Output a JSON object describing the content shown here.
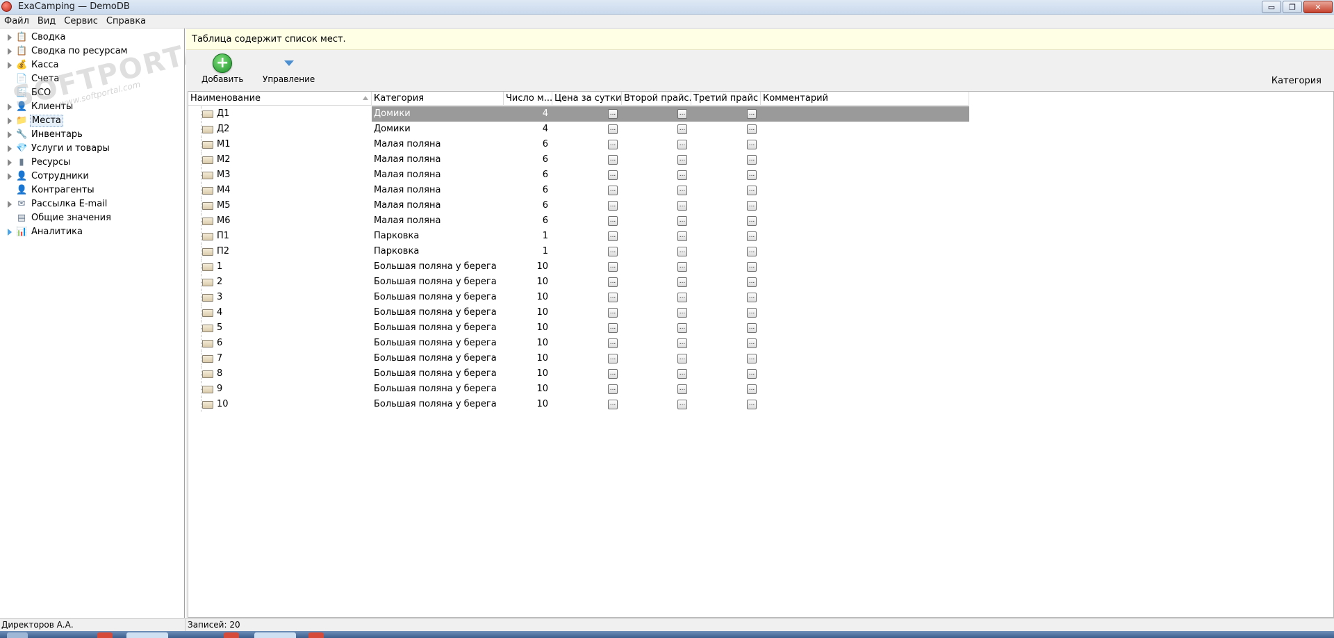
{
  "window": {
    "title": "ExaCamping — DemoDB",
    "min_label": "▭",
    "max_label": "❐",
    "close_label": "✕"
  },
  "menu": [
    "Файл",
    "Вид",
    "Сервис",
    "Справка"
  ],
  "sidebar": {
    "items": [
      {
        "label": "Сводка",
        "icon": "📋",
        "has_arrow": true
      },
      {
        "label": "Сводка по ресурсам",
        "icon": "📋",
        "has_arrow": true
      },
      {
        "label": "Касса",
        "icon": "💰",
        "has_arrow": true
      },
      {
        "label": "Счета",
        "icon": "📄",
        "has_arrow": false
      },
      {
        "label": "БСО",
        "icon": "🧾",
        "has_arrow": false
      },
      {
        "label": "Клиенты",
        "icon": "👤",
        "has_arrow": true
      },
      {
        "label": "Места",
        "icon": "📁",
        "has_arrow": true,
        "selected": true
      },
      {
        "label": "Инвентарь",
        "icon": "🔧",
        "has_arrow": true
      },
      {
        "label": "Услуги и товары",
        "icon": "💎",
        "has_arrow": true
      },
      {
        "label": "Ресурсы",
        "icon": "▮",
        "has_arrow": true
      },
      {
        "label": "Сотрудники",
        "icon": "👤",
        "has_arrow": true
      },
      {
        "label": "Контрагенты",
        "icon": "👤",
        "has_arrow": false
      },
      {
        "label": "Рассылка E-mail",
        "icon": "✉",
        "has_arrow": true
      },
      {
        "label": "Общие значения",
        "icon": "▤",
        "has_arrow": false
      },
      {
        "label": "Аналитика",
        "icon": "📊",
        "has_arrow": true,
        "blue_arrow": true
      }
    ]
  },
  "watermark": {
    "main": "SOFTPORTAL",
    "sub": "www.softportal.com"
  },
  "info_text": "Таблица содержит список мест.",
  "toolbar": {
    "add_label": "Добавить",
    "manage_label": "Управление",
    "category_label": "Категория"
  },
  "grid": {
    "columns": [
      "Наименование",
      "Категория",
      "Число м...",
      "Цена за сутки",
      "Второй прайс...",
      "Третий прайс ...",
      "Комментарий"
    ],
    "ellipsis": "...",
    "rows": [
      {
        "name": "Д1",
        "category": "Домики",
        "count": "4"
      },
      {
        "name": "Д2",
        "category": "Домики",
        "count": "4"
      },
      {
        "name": "М1",
        "category": "Малая поляна",
        "count": "6"
      },
      {
        "name": "М2",
        "category": "Малая поляна",
        "count": "6"
      },
      {
        "name": "М3",
        "category": "Малая поляна",
        "count": "6"
      },
      {
        "name": "М4",
        "category": "Малая поляна",
        "count": "6"
      },
      {
        "name": "М5",
        "category": "Малая поляна",
        "count": "6"
      },
      {
        "name": "М6",
        "category": "Малая поляна",
        "count": "6"
      },
      {
        "name": "П1",
        "category": "Парковка",
        "count": "1"
      },
      {
        "name": "П2",
        "category": "Парковка",
        "count": "1"
      },
      {
        "name": "1",
        "category": "Большая поляна у берега",
        "count": "10"
      },
      {
        "name": "2",
        "category": "Большая поляна у берега",
        "count": "10"
      },
      {
        "name": "3",
        "category": "Большая поляна у берега",
        "count": "10"
      },
      {
        "name": "4",
        "category": "Большая поляна у берега",
        "count": "10"
      },
      {
        "name": "5",
        "category": "Большая поляна у берега",
        "count": "10"
      },
      {
        "name": "6",
        "category": "Большая поляна у берега",
        "count": "10"
      },
      {
        "name": "7",
        "category": "Большая поляна у берега",
        "count": "10"
      },
      {
        "name": "8",
        "category": "Большая поляна у берега",
        "count": "10"
      },
      {
        "name": "9",
        "category": "Большая поляна у берега",
        "count": "10"
      },
      {
        "name": "10",
        "category": "Большая поляна у берега",
        "count": "10"
      }
    ]
  },
  "status": {
    "user": "Директоров А.А.",
    "records": "Записей: 20"
  },
  "colors": {
    "selected_row": "#9a9a9a",
    "info_bar": "#ffffe6",
    "add_green": "#1c8f2a",
    "accent_blue": "#4b8fd0"
  }
}
